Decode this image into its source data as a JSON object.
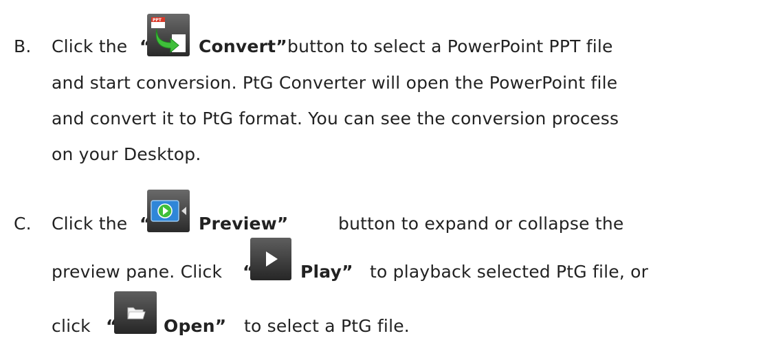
{
  "items": {
    "b": {
      "marker": "B.",
      "l1_pre": "Click the",
      "quote_open": "“",
      "button_label": "Convert”",
      "l1_post": "button to select a PowerPoint PPT file",
      "l2": "and start conversion. PtG Converter will open the PowerPoint file",
      "l3": "and convert it to PtG format. You can see the conversion process",
      "l4": "on your Desktop."
    },
    "c": {
      "marker": "C.",
      "l1_pre": "Click the",
      "quote_open": "“",
      "button_label": "Preview”",
      "l1_post": "button to expand or collapse the",
      "l2_pre": "preview pane. Click",
      "play_quote_open": "“",
      "play_label": "Play”",
      "l2_post": "to playback selected PtG file, or",
      "l3_pre": "click",
      "open_quote_open": "“",
      "open_label": "Open”",
      "l3_post": "to select a PtG file."
    }
  },
  "icons": {
    "convert": {
      "name": "ppt-convert-icon",
      "badge": "PPT",
      "badge_color": "#d93a2a",
      "arrow_color": "#3fbf3a"
    },
    "preview": {
      "name": "preview-video-icon",
      "screen_color": "#2f86d8",
      "play_color": "#3fbf3a"
    },
    "play": {
      "name": "play-icon",
      "bg_color": "#444444"
    },
    "open": {
      "name": "folder-open-icon",
      "bg_color": "#444444"
    }
  }
}
